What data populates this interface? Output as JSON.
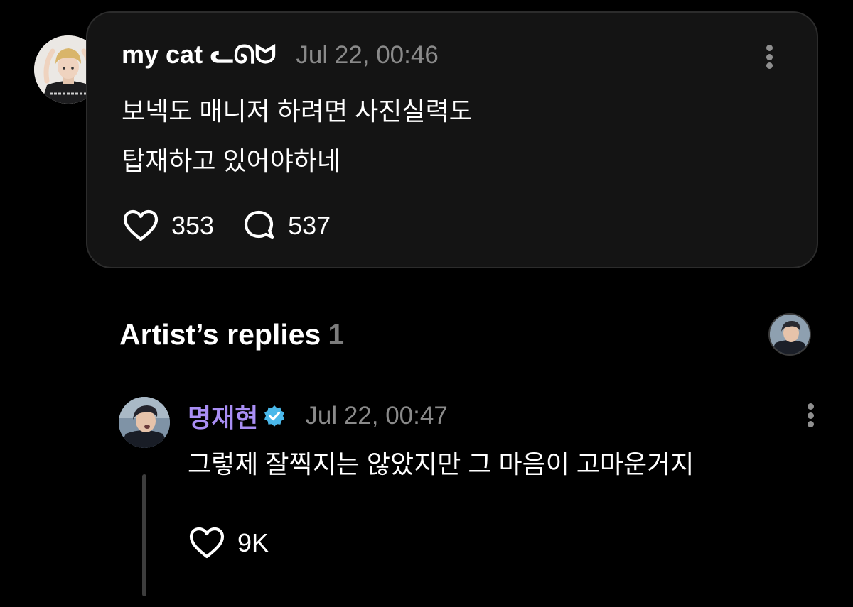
{
  "post": {
    "author": "my cat ᓚᘏᗢ",
    "timestamp": "Jul 22, 00:46",
    "text_lines": [
      "보넥도 매니저 하려면 사진실력도",
      "탑재하고 있어야하네"
    ],
    "likes": "353",
    "comments": "537"
  },
  "artist_replies": {
    "title": "Artist’s replies",
    "count": "1"
  },
  "reply": {
    "author": "명재현",
    "verified": true,
    "timestamp": "Jul 22, 00:47",
    "text": "그렇제 잘찍지는 않았지만 그 마음이 고마운거지",
    "likes": "9K"
  },
  "icons": {
    "like": "heart-icon",
    "comment": "comment-bubble-icon",
    "more": "more-vertical-icon",
    "verified": "verified-badge-icon"
  },
  "colors": {
    "background": "#000000",
    "card": "#141414",
    "artist_name": "#a98ef4",
    "verified_badge": "#4ab8ea",
    "muted_text": "#8a8a8a"
  }
}
